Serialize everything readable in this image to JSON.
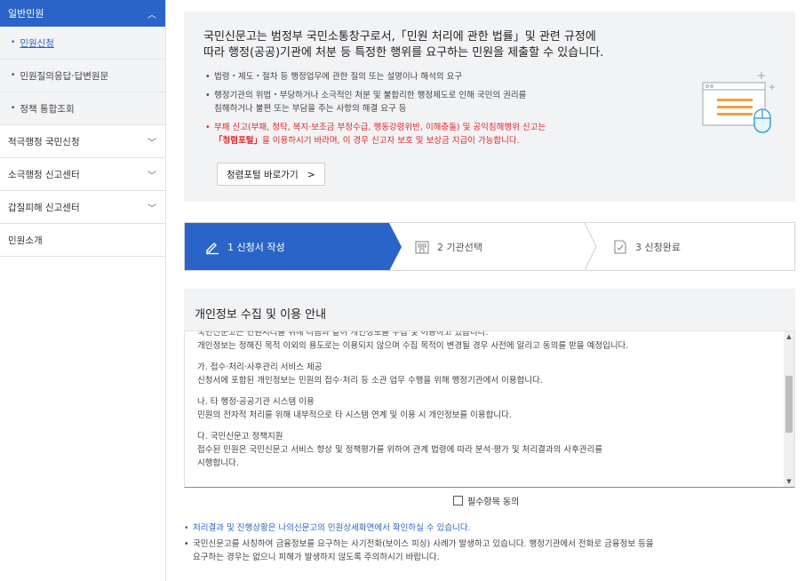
{
  "sidebar": {
    "top": {
      "label": "일반민원"
    },
    "sub_items": [
      {
        "label": "민원신청",
        "active": true
      },
      {
        "label": "민원질의응답·답변원문"
      },
      {
        "label": "정책 통합조회"
      }
    ],
    "menu_items": [
      {
        "label": "적극행정 국민신청",
        "expandable": true
      },
      {
        "label": "소극행정 신고센터",
        "expandable": true
      },
      {
        "label": "갑질피해 신고센터",
        "expandable": true
      },
      {
        "label": "민원소개",
        "expandable": false
      }
    ]
  },
  "info": {
    "title_line1": "국민신문고는 범정부 국민소통창구로서,「민원 처리에 관한 법률」및 관련 규정에",
    "title_line2": "따라 행정(공공)기관에 처분 등 특정한 행위를 요구하는 민원을 제출할 수 있습니다.",
    "bullet1": "법령・제도・절차 등 행정업무에 관한 질의 또는 설명이나 해석의 요구",
    "bullet2_line1": "행정기관의 위법・부당하거나 소극적인 처분 및 불합리한 행정제도로 인해 국민의 권리를",
    "bullet2_line2": "침해하거나 불편 또는 부담을 주는 사항의 해결 요구 등",
    "bullet3_line1": "부패 신고(부패, 청탁, 복지·보조금 부정수급, 행동강령위반, 이해충돌) 및 공익침해행위 신고는",
    "bullet3_portal": "「청렴포털」",
    "bullet3_line2_rest": "을 이용하시기 바라며, 이 경우 신고자 보호 및 보상금 지급이 가능합니다.",
    "portal_button": "청렴포털 바로가기",
    "portal_arrow": ">"
  },
  "steps": [
    {
      "label": "1 신청서 작성",
      "active": true
    },
    {
      "label": "2 기관선택",
      "active": false
    },
    {
      "label": "3 신청완료",
      "active": false
    }
  ],
  "privacy": {
    "title": "개인정보 수집 및 이용 안내",
    "cut_line": "국민신문고는 민원처리를 위해 다음과 같이 개인정보를 수집 및 이용하고 있습니다.",
    "intro": "개인정보는 정해진 목적 이외의 용도로는 이용되지 않으며 수집 목적이 변경될 경우 사전에 알리고 동의를 받을 예정입니다.",
    "sec_a_title": "가. 접수·처리·사후관리 서비스 제공",
    "sec_a_body": "신청서에 포함된 개인정보는 민원의 접수·처리 등 소관 업무 수행을 위해 행정기관에서 이용합니다.",
    "sec_b_title": "나. 타 행정·공공기관 시스템 이용",
    "sec_b_body": "민원의 전자적 처리를 위해 내부적으로 타 시스템 연계 및 이용 시 개인정보를 이용합니다.",
    "sec_c_title": "다. 국민신문고 정책지원",
    "sec_c_body1": "접수된 민원은 국민신문고 서비스 향상 및 정책평가를 위하여 관계 법령에 따라 분석·평가 및 처리결과의 사후관리를",
    "sec_c_body2": "시행합니다."
  },
  "agree": {
    "label": "필수항목 동의"
  },
  "notes": {
    "note1": "처리결과 및 진행상황은 나의신문고의 민원상세화면에서 확인하실 수 있습니다.",
    "note2_line1": "국민신문고를 사칭하여 금융정보를 요구하는 사기전화(보이스 피싱) 사례가 발생하고 있습니다. 행정기관에서 전화로 금융정보 등을",
    "note2_line2": "요구하는 경우는 없으니 피해가 발생하지 않도록 주의하시기 바랍니다."
  },
  "colors": {
    "accent": "#2a64c8",
    "warning": "#e3262b",
    "panel": "#f2f3f5"
  }
}
